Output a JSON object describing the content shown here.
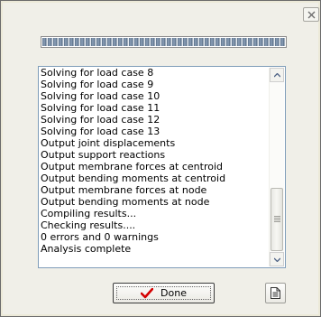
{
  "window": {
    "close_icon": "close-icon"
  },
  "progress": {
    "fraction": 1.0
  },
  "log": {
    "lines": [
      "Solving for load case 8",
      "Solving for load case 9",
      "Solving for load case 10",
      "Solving for load case 11",
      "Solving for load case 12",
      "Solving for load case 13",
      "Output joint displacements",
      "Output support reactions",
      "Output membrane forces at centroid",
      "Output bending moments at centroid",
      "Output membrane forces at node",
      "Output bending moments at node",
      "Compiling results...",
      "Checking results....",
      "0 errors and 0 warnings",
      "Analysis complete"
    ]
  },
  "buttons": {
    "done_label": "Done",
    "done_icon": "red-checkmark-icon",
    "report_icon": "document-icon"
  },
  "colors": {
    "checkmark": "#d40000",
    "progress": "#5a6f88"
  }
}
